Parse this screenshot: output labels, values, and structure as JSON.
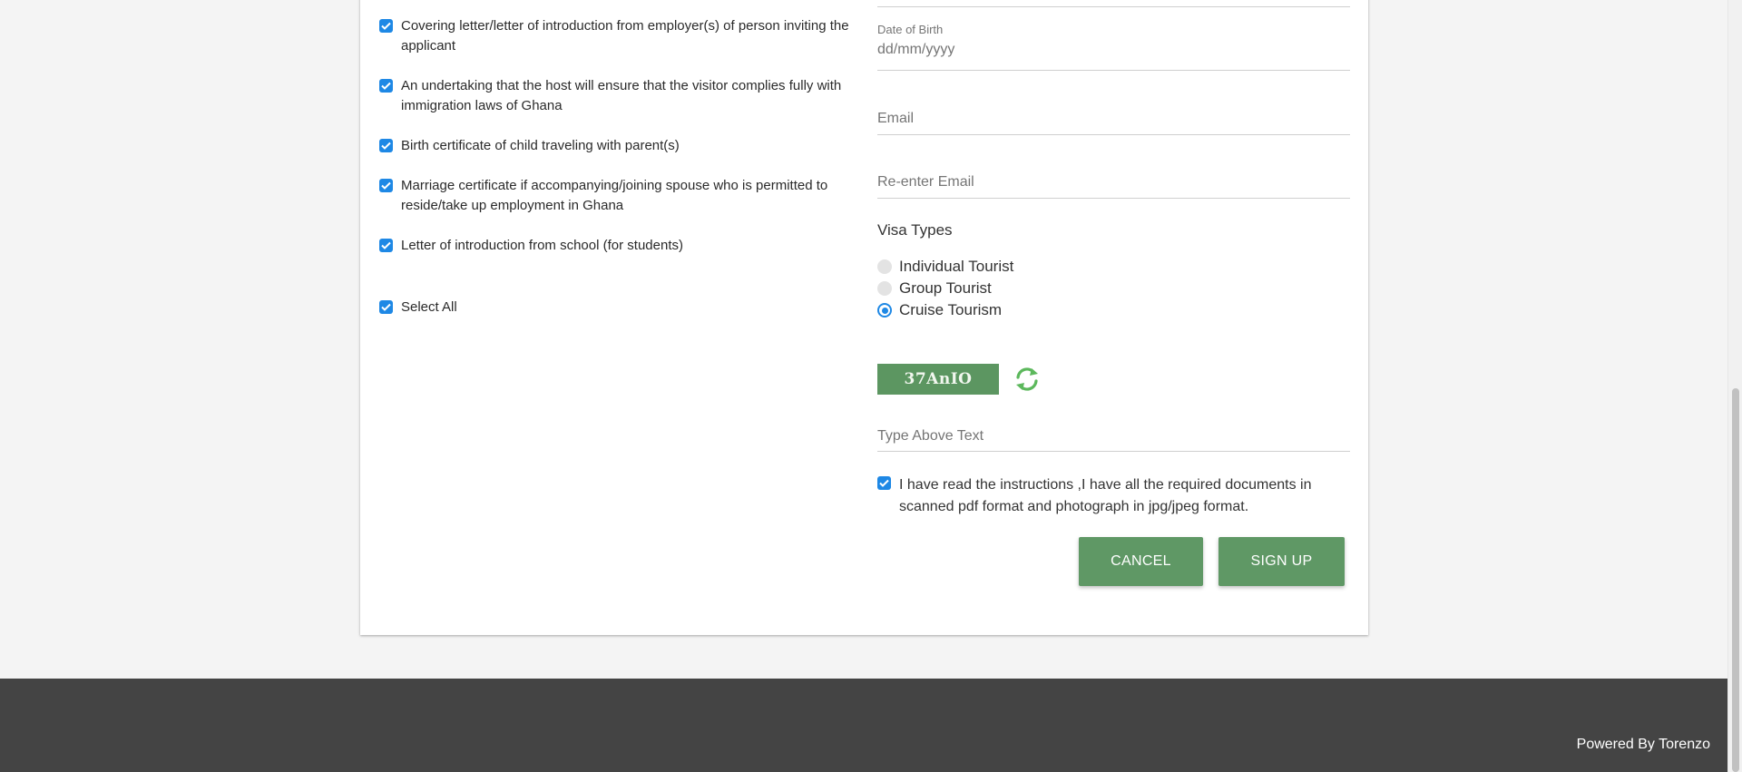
{
  "documents": [
    {
      "label": "Covering letter/letter of introduction from employer(s) of person inviting the applicant",
      "checked": true
    },
    {
      "label": "An undertaking that the host will ensure that the visitor complies fully with immigration laws of Ghana",
      "checked": true
    },
    {
      "label": "Birth certificate of child traveling with parent(s)",
      "checked": true
    },
    {
      "label": "Marriage certificate if accompanying/joining spouse who is permitted to reside/take up employment in Ghana",
      "checked": true
    },
    {
      "label": "Letter of introduction from school (for students)",
      "checked": true
    }
  ],
  "select_all": {
    "label": "Select All",
    "checked": true
  },
  "form": {
    "dob_label": "Date of Birth",
    "dob_placeholder": "dd/mm/yyyy",
    "email_placeholder": "Email",
    "reenter_email_placeholder": "Re-enter Email",
    "captcha_input_placeholder": "Type Above Text"
  },
  "visa_types": {
    "title": "Visa Types",
    "options": [
      {
        "label": "Individual Tourist",
        "selected": false
      },
      {
        "label": "Group Tourist",
        "selected": false
      },
      {
        "label": "Cruise Tourism",
        "selected": true
      }
    ]
  },
  "captcha": {
    "text": "37AnIO",
    "refresh_icon": "refresh-icon"
  },
  "agreement": {
    "label": "I have read the instructions ,I have all the required documents in scanned pdf format and photograph in jpg/jpeg format.",
    "checked": true
  },
  "buttons": {
    "cancel": "CANCEL",
    "signup": "SIGN UP"
  },
  "footer": {
    "powered_by": "Powered By Torenzo"
  },
  "colors": {
    "accent_blue": "#1e88e5",
    "button_green": "#5f9865",
    "captcha_green": "#5c9661",
    "footer_bg": "#444444"
  }
}
